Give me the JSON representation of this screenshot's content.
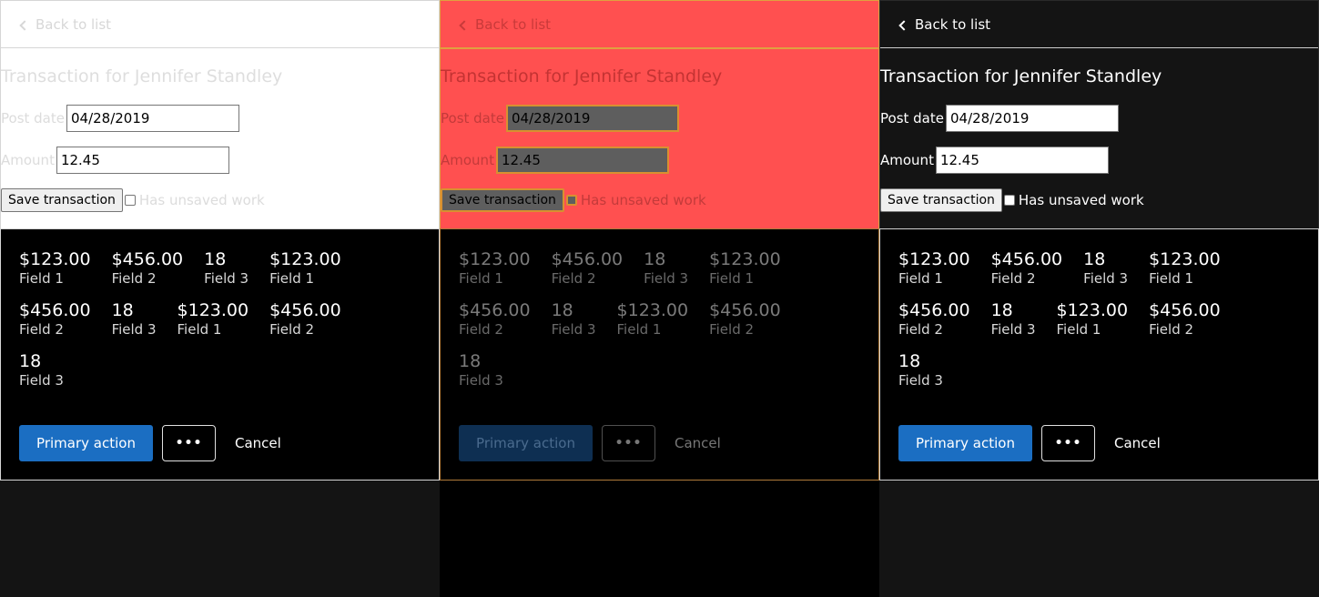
{
  "nav": {
    "back_label": "Back to list"
  },
  "form": {
    "title": "Transaction for Jennifer Standley",
    "post_date_label": "Post date",
    "post_date_value": "04/28/2019",
    "amount_label": "Amount",
    "amount_value": "12.45",
    "save_label": "Save transaction",
    "unsaved_label": "Has unsaved work"
  },
  "stats": [
    {
      "value": "$123.00",
      "label": "Field 1"
    },
    {
      "value": "$456.00",
      "label": "Field 2"
    },
    {
      "value": "18",
      "label": "Field 3"
    },
    {
      "value": "$123.00",
      "label": "Field 1"
    },
    {
      "value": "$456.00",
      "label": "Field 2"
    },
    {
      "value": "18",
      "label": "Field 3"
    },
    {
      "value": "$123.00",
      "label": "Field 1"
    },
    {
      "value": "$456.00",
      "label": "Field 2"
    },
    {
      "value": "18",
      "label": "Field 3"
    }
  ],
  "actions": {
    "primary_label": "Primary action",
    "more_label": "•••",
    "cancel_label": "Cancel"
  },
  "colors": {
    "accent": "#1b6ec2",
    "error_background": "#ff5050",
    "focus_outline": "#e0a040"
  }
}
